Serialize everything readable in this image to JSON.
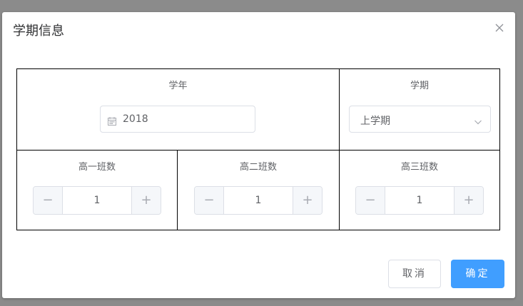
{
  "dialog": {
    "title": "学期信息",
    "close_icon": "close-icon"
  },
  "form": {
    "year": {
      "label": "学年",
      "value": "2018",
      "icon": "calendar-icon"
    },
    "term": {
      "label": "学期",
      "value": "上学期",
      "icon": "chevron-down-icon"
    },
    "classes": [
      {
        "label": "高一班数",
        "value": "1",
        "minus": "−",
        "plus": "+"
      },
      {
        "label": "高二班数",
        "value": "1",
        "minus": "−",
        "plus": "+"
      },
      {
        "label": "高三班数",
        "value": "1",
        "minus": "−",
        "plus": "+"
      }
    ]
  },
  "footer": {
    "cancel_label": "取消",
    "ok_label": "确定"
  },
  "colors": {
    "primary": "#409eff",
    "border": "#dcdfe6",
    "text": "#606266",
    "overlay": "#8b8b8b"
  }
}
